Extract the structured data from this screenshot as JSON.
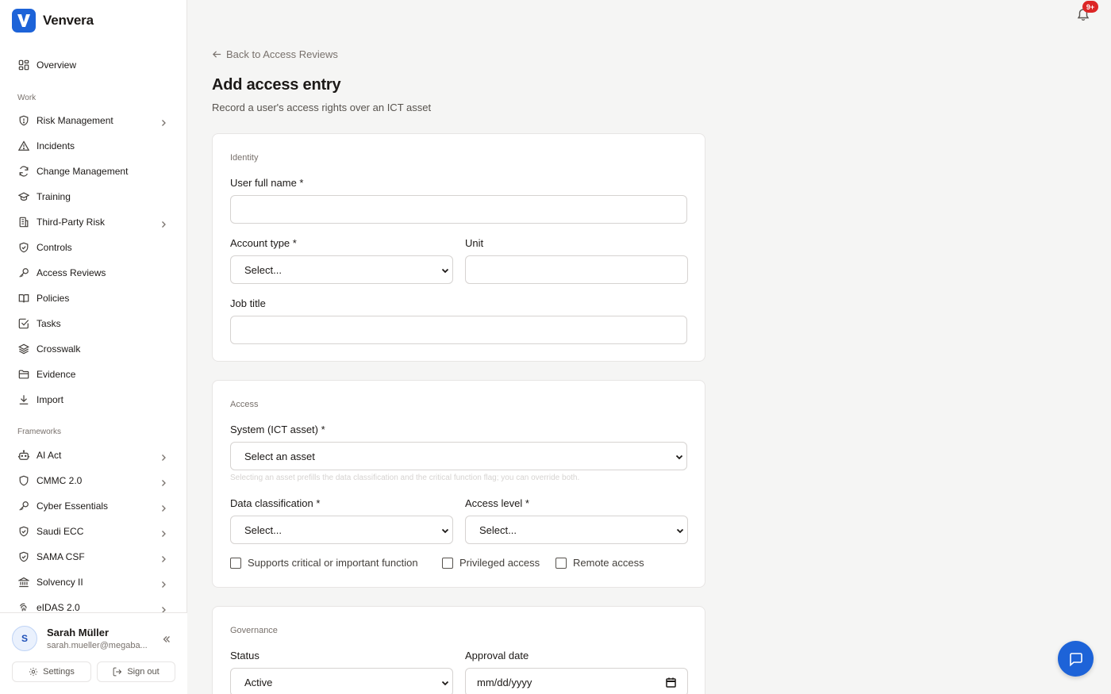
{
  "brand": {
    "name": "Venvera",
    "logo_letter": "V",
    "accent": "#1d63d8"
  },
  "nav": {
    "overview": "Overview",
    "work_section": "Work",
    "work_items": [
      {
        "label": "Risk Management",
        "icon": "shield-icon",
        "has_submenu": true
      },
      {
        "label": "Incidents",
        "icon": "alert-triangle-icon",
        "has_submenu": false
      },
      {
        "label": "Change Management",
        "icon": "refresh-icon",
        "has_submenu": false
      },
      {
        "label": "Training",
        "icon": "graduation-cap-icon",
        "has_submenu": false
      },
      {
        "label": "Third-Party Risk",
        "icon": "building-icon",
        "has_submenu": true
      },
      {
        "label": "Controls",
        "icon": "shield-check-icon",
        "has_submenu": false
      },
      {
        "label": "Access Reviews",
        "icon": "key-icon",
        "has_submenu": false
      },
      {
        "label": "Policies",
        "icon": "book-icon",
        "has_submenu": false
      },
      {
        "label": "Tasks",
        "icon": "check-square-icon",
        "has_submenu": false
      },
      {
        "label": "Crosswalk",
        "icon": "layers-icon",
        "has_submenu": false
      },
      {
        "label": "Evidence",
        "icon": "folder-icon",
        "has_submenu": false
      },
      {
        "label": "Import",
        "icon": "download-icon",
        "has_submenu": false
      }
    ],
    "frameworks_section": "Frameworks",
    "framework_items": [
      {
        "label": "AI Act",
        "icon": "bot-icon"
      },
      {
        "label": "CMMC 2.0",
        "icon": "shield-icon"
      },
      {
        "label": "Cyber Essentials",
        "icon": "key-icon"
      },
      {
        "label": "Saudi ECC",
        "icon": "shield-check-icon"
      },
      {
        "label": "SAMA CSF",
        "icon": "shield-check-icon"
      },
      {
        "label": "Solvency II",
        "icon": "landmark-icon"
      },
      {
        "label": "eIDAS 2.0",
        "icon": "fingerprint-icon"
      }
    ]
  },
  "user": {
    "initial": "S",
    "name": "Sarah Müller",
    "email": "sarah.mueller@megaba...",
    "settings_label": "Settings",
    "signout_label": "Sign out"
  },
  "header": {
    "notification_count": "9+"
  },
  "page": {
    "back_label": "Back to Access Reviews",
    "title": "Add access entry",
    "subtitle": "Record a user's access rights over an ICT asset"
  },
  "identity": {
    "section_title": "Identity",
    "user_full_name_label": "User full name *",
    "user_full_name_value": "",
    "account_type_label": "Account type *",
    "account_type_value": "Select...",
    "unit_label": "Unit",
    "unit_value": "",
    "job_title_label": "Job title",
    "job_title_value": ""
  },
  "access": {
    "section_title": "Access",
    "system_label": "System (ICT asset) *",
    "system_value": "Select an asset",
    "system_hint": "Selecting an asset prefills the data classification and the critical function flag; you can override both.",
    "data_classification_label": "Data classification *",
    "data_classification_value": "Select...",
    "access_level_label": "Access level *",
    "access_level_value": "Select...",
    "checkboxes": [
      {
        "label": "Supports critical or important function",
        "checked": false
      },
      {
        "label": "Privileged access",
        "checked": false
      },
      {
        "label": "Remote access",
        "checked": false
      }
    ]
  },
  "governance": {
    "section_title": "Governance",
    "status_label": "Status",
    "status_value": "Active",
    "approval_date_label": "Approval date",
    "approval_date_placeholder": "mm/dd/yyyy"
  }
}
